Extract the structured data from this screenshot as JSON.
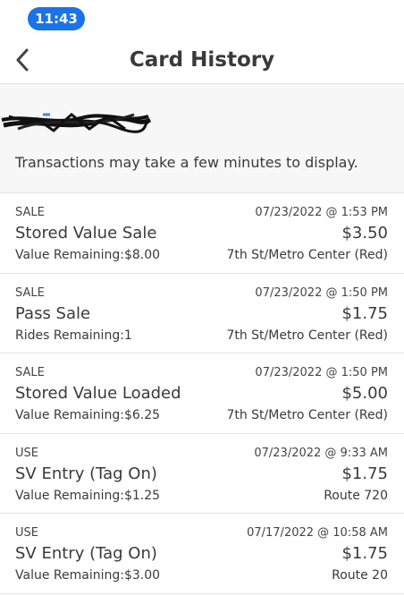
{
  "status": {
    "time": "11:43"
  },
  "header": {
    "title": "Card History",
    "back_icon": "chevron-left-icon"
  },
  "card": {
    "info": "Transactions may take a few minutes to display."
  },
  "transactions": [
    {
      "type": "SALE",
      "date": "07/23/2022 @ 1:53 PM",
      "title": "Stored Value Sale",
      "amount": "$3.50",
      "remaining": "Value Remaining:$8.00",
      "location": "7th St/Metro Center (Red)"
    },
    {
      "type": "SALE",
      "date": "07/23/2022 @ 1:50 PM",
      "title": "Pass Sale",
      "amount": "$1.75",
      "remaining": "Rides Remaining:1",
      "location": "7th St/Metro Center (Red)"
    },
    {
      "type": "SALE",
      "date": "07/23/2022 @ 1:50 PM",
      "title": "Stored Value Loaded",
      "amount": "$5.00",
      "remaining": "Value Remaining:$6.25",
      "location": "7th St/Metro Center (Red)"
    },
    {
      "type": "USE",
      "date": "07/23/2022 @ 9:33 AM",
      "title": "SV Entry (Tag On)",
      "amount": "$1.75",
      "remaining": "Value Remaining:$1.25",
      "location": "Route 720"
    },
    {
      "type": "USE",
      "date": "07/17/2022 @ 10:58 AM",
      "title": "SV Entry (Tag On)",
      "amount": "$1.75",
      "remaining": "Value Remaining:$3.00",
      "location": "Route 20"
    }
  ],
  "colors": {
    "accent": "#1a73e8",
    "section_bg": "#f7f7f7",
    "divider": "#e3e3e3"
  }
}
